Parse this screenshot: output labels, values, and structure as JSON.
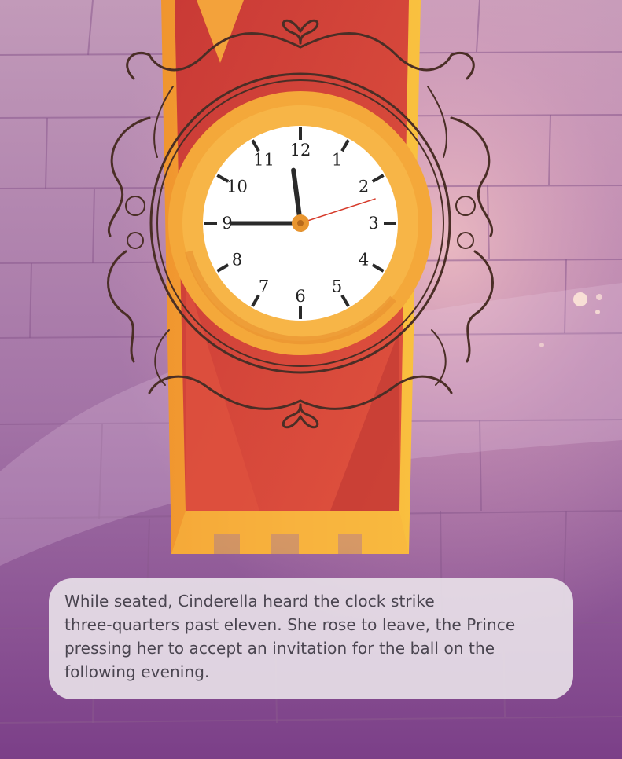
{
  "caption": {
    "lines": [
      "While seated, Cinderella heard the clock strike",
      "three-quarters past eleven. She rose to leave, the Prince",
      "pressing her to accept an invitation for the ball on the",
      "following evening."
    ]
  },
  "clock": {
    "numbers": [
      "12",
      "1",
      "2",
      "3",
      "4",
      "5",
      "6",
      "7",
      "8",
      "9",
      "10",
      "11"
    ],
    "time": {
      "hour": 11,
      "minute": 45,
      "second": 12
    },
    "colors": {
      "rim": "#f4a83a",
      "face": "#ffffff",
      "hand": "#2a2a2a",
      "second_hand": "#d63a2a"
    }
  },
  "scene": {
    "colors": {
      "wall_top": "#b98ab0",
      "wall_bottom": "#7a3f86",
      "banner_red": "#d4453a",
      "banner_gold": "#f4a83a"
    }
  }
}
